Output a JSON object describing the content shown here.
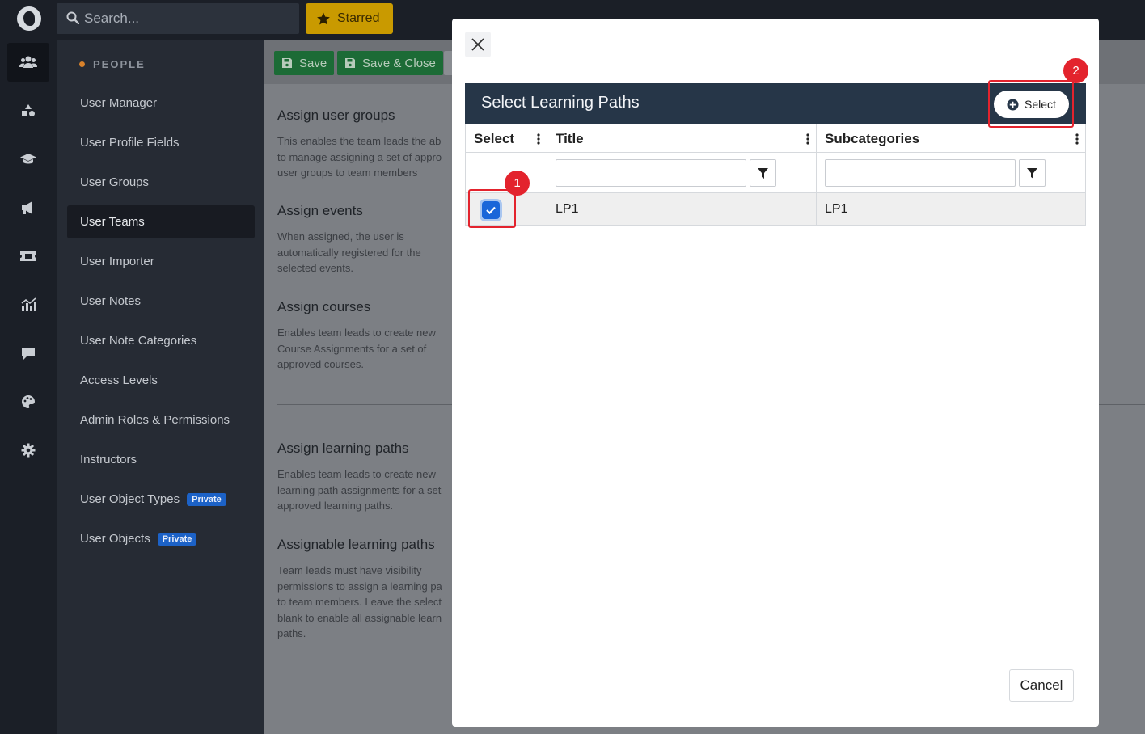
{
  "topbar": {
    "search_placeholder": "Search...",
    "starred_label": "Starred"
  },
  "rail": {
    "icons": [
      "people-icon",
      "shapes-icon",
      "graduation-cap-icon",
      "megaphone-icon",
      "ticket-icon",
      "analytics-icon",
      "comment-icon",
      "palette-icon",
      "gear-icon"
    ],
    "active": "people-icon"
  },
  "nav": {
    "heading": "PEOPLE",
    "items": [
      {
        "label": "User Manager"
      },
      {
        "label": "User Profile Fields"
      },
      {
        "label": "User Groups"
      },
      {
        "label": "User Teams",
        "active": true
      },
      {
        "label": "User Importer"
      },
      {
        "label": "User Notes"
      },
      {
        "label": "User Note Categories"
      },
      {
        "label": "Access Levels"
      },
      {
        "label": "Admin Roles & Permissions"
      },
      {
        "label": "Instructors"
      },
      {
        "label": "User Object Types",
        "badge": "Private"
      },
      {
        "label": "User Objects",
        "badge": "Private"
      }
    ]
  },
  "toolbar": {
    "save_label": "Save",
    "save_close_label": "Save & Close"
  },
  "sections": [
    {
      "title": "Assign user groups",
      "lines": [
        "This enables the team leads the ab",
        "to manage assigning a set of appro",
        "user groups to team members"
      ]
    },
    {
      "title": "Assign events",
      "lines": [
        "When assigned, the user is",
        "automatically registered for the",
        "selected events."
      ]
    },
    {
      "title": "Assign courses",
      "lines": [
        "Enables team leads to create new",
        "Course Assignments for a set of",
        "approved courses."
      ]
    },
    {
      "title": "Assign learning paths",
      "lines": [
        "Enables team leads to create new",
        "learning path assignments for a set",
        "approved learning paths."
      ]
    },
    {
      "title": "Assignable learning paths",
      "lines": [
        "Team leads must have visibility",
        "permissions to assign a learning pa",
        "to team members. Leave the select",
        "blank to enable all assignable learn",
        "paths."
      ]
    }
  ],
  "modal": {
    "title": "Select Learning Paths",
    "select_button": "Select",
    "columns": [
      "Select",
      "Title",
      "Subcategories"
    ],
    "rows": [
      {
        "selected": true,
        "title": "LP1",
        "subcategories": "LP1"
      }
    ],
    "cancel_label": "Cancel"
  },
  "annotations": [
    "1",
    "2"
  ],
  "colors": {
    "panel_header": "#263648",
    "checkbox": "#1a66d9",
    "annotation": "#e3232d",
    "starred": "#c99a00",
    "save": "#1c6b36"
  }
}
